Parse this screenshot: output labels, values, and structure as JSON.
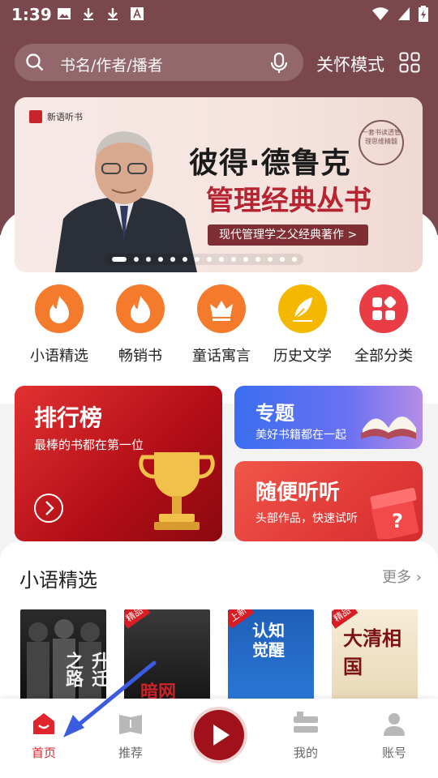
{
  "status_bar": {
    "time": "1:39"
  },
  "search": {
    "placeholder": "书名/作者/播者"
  },
  "header": {
    "care_mode": "关怀模式"
  },
  "banner": {
    "brand": "新语听书",
    "title": "彼得·德鲁克",
    "subtitle": "管理经典丛书",
    "tagline": "现代管理学之父经典著作 >",
    "seal_text": "一套书读透管理思维精髓"
  },
  "categories": [
    {
      "label": "小语精选",
      "icon": "flame-icon",
      "color": "#f47a2c"
    },
    {
      "label": "畅销书",
      "icon": "flame-icon",
      "color": "#f47a2c"
    },
    {
      "label": "童话寓言",
      "icon": "crown-icon",
      "color": "#f47a2c"
    },
    {
      "label": "历史文学",
      "icon": "feather-icon",
      "color": "#f5b800"
    },
    {
      "label": "全部分类",
      "icon": "grid-icon",
      "color": "#ea3c44"
    }
  ],
  "cards": {
    "ranking": {
      "title": "排行榜",
      "subtitle": "最棒的书都在第一位"
    },
    "topic": {
      "title": "专题",
      "subtitle": "美好书籍都在一起"
    },
    "random": {
      "title": "随便听听",
      "subtitle": "头部作品，快速试听"
    }
  },
  "section": {
    "title": "小语精选",
    "more": "更多",
    "books": [
      {
        "title": "升迁之路",
        "badge": ""
      },
      {
        "title": "暗网",
        "badge": "精品"
      },
      {
        "title": "认知觉醒",
        "badge": "上新"
      },
      {
        "title": "大清相国",
        "badge": "精品"
      }
    ]
  },
  "tabbar": [
    {
      "label": "首页",
      "icon": "home-icon",
      "active": true
    },
    {
      "label": "推荐",
      "icon": "book-open-icon",
      "active": false
    },
    {
      "label": "我的",
      "icon": "books-icon",
      "active": false
    },
    {
      "label": "账号",
      "icon": "user-icon",
      "active": false
    }
  ],
  "colors": {
    "header": "#7a474d",
    "accent": "#d81d25",
    "annotation_arrow": "#3b5be0"
  }
}
